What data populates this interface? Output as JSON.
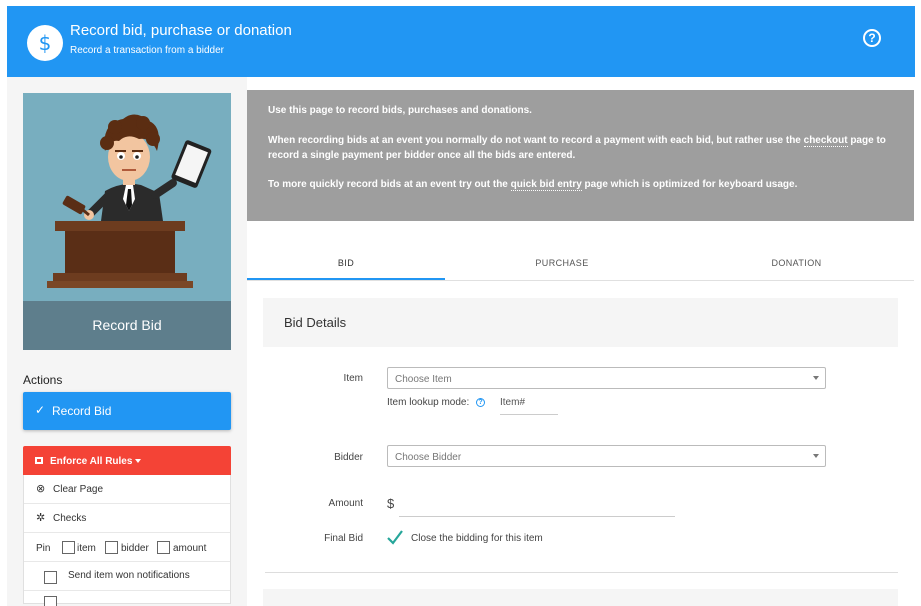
{
  "header": {
    "logo_symbol": "$",
    "title": "Record bid, purchase or donation",
    "subtitle": "Record a transaction from a bidder",
    "help_symbol": "?"
  },
  "sidebar": {
    "hero_caption": "Record Bid",
    "actions_label": "Actions",
    "record_button": {
      "check": "✓",
      "label": "Record Bid"
    },
    "rules_button": {
      "label": "Enforce All Rules"
    },
    "items": [
      {
        "symbol": "⊗",
        "label": "Clear Page"
      },
      {
        "symbol": "✲",
        "label": "Checks"
      }
    ],
    "pin": {
      "label": "Pin",
      "options": [
        "item",
        "bidder",
        "amount"
      ]
    },
    "notify_label": "Send item won notifications"
  },
  "info": {
    "line1": "Use this page to record bids, purchases and donations.",
    "line2_pre": "When recording bids at an event you normally do ",
    "line2_not": "not",
    "line2_mid": " want to record a payment with each bid, but rather use the ",
    "line2_link": "checkout",
    "line2_post": " page to record a single payment per bidder once all the bids are entered.",
    "line3_pre": "To more quickly record bids at an event try out the ",
    "line3_link": "quick bid entry",
    "line3_post": " page which is optimized for keyboard usage."
  },
  "tabs": [
    {
      "label": "BID",
      "active": true
    },
    {
      "label": "PURCHASE",
      "active": false
    },
    {
      "label": "DONATION",
      "active": false
    }
  ],
  "form": {
    "card_title": "Bid Details",
    "item_label": "Item",
    "item_placeholder": "Choose Item",
    "lookup_label": "Item lookup mode:",
    "lookup_help": "?",
    "lookup_value": "Item#",
    "bidder_label": "Bidder",
    "bidder_placeholder": "Choose Bidder",
    "amount_label": "Amount",
    "currency": "$",
    "amount_value": "",
    "final_bid_label": "Final Bid",
    "final_bid_checked": true,
    "final_bid_text": "Close the bidding for this item"
  },
  "colors": {
    "primary": "#2196f3",
    "danger": "#f44336",
    "info_bg": "#9e9e9e",
    "hero_bg": "#78aebf",
    "check_teal": "#26a69a"
  }
}
